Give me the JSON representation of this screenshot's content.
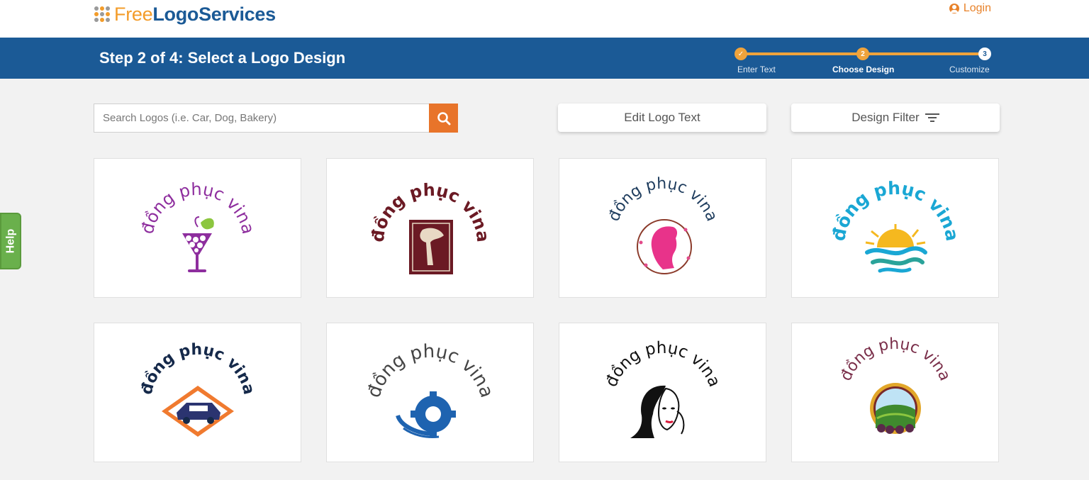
{
  "header": {
    "logo_part1": "Free",
    "logo_part2": "LogoServices",
    "login_label": "Login"
  },
  "stepbar": {
    "title": "Step 2 of 4: Select a Logo Design",
    "steps": [
      {
        "number": "✓",
        "label": "Enter Text"
      },
      {
        "number": "2",
        "label": "Choose Design"
      },
      {
        "number": "3",
        "label": "Customize"
      }
    ]
  },
  "search": {
    "placeholder": "Search Logos (i.e. Car, Dog, Bakery)",
    "value": ""
  },
  "actions": {
    "edit_label": "Edit Logo Text",
    "filter_label": "Design Filter"
  },
  "help_label": "Help",
  "colors": {
    "brand_blue": "#1b5a96",
    "brand_orange": "#f39c2a",
    "search_button": "#e8742a",
    "help_green": "#6ab04c"
  },
  "logos": [
    {
      "text": "đồng phục vina",
      "text_color": "#8e2e9e",
      "icon": "grape-cocktail-icon"
    },
    {
      "text": "đồng phục vina",
      "text_color": "#6b1a24",
      "icon": "grapevine-frame-icon"
    },
    {
      "text": "đồng phục vina",
      "text_color": "#1f3d5e",
      "icon": "woman-profile-wreath-icon"
    },
    {
      "text": "đồng phục vina",
      "text_color": "#1aa7d4",
      "icon": "sun-waves-icon"
    },
    {
      "text": "đồng phục vina",
      "text_color": "#15294a",
      "icon": "car-diamond-icon"
    },
    {
      "text": "đồng phục vina",
      "text_color": "#444444",
      "icon": "gear-icon"
    },
    {
      "text": "đồng phục vina",
      "text_color": "#111111",
      "icon": "woman-face-icon"
    },
    {
      "text": "đồng phục vina",
      "text_color": "#7a2f4a",
      "icon": "vineyard-emblem-icon"
    }
  ]
}
